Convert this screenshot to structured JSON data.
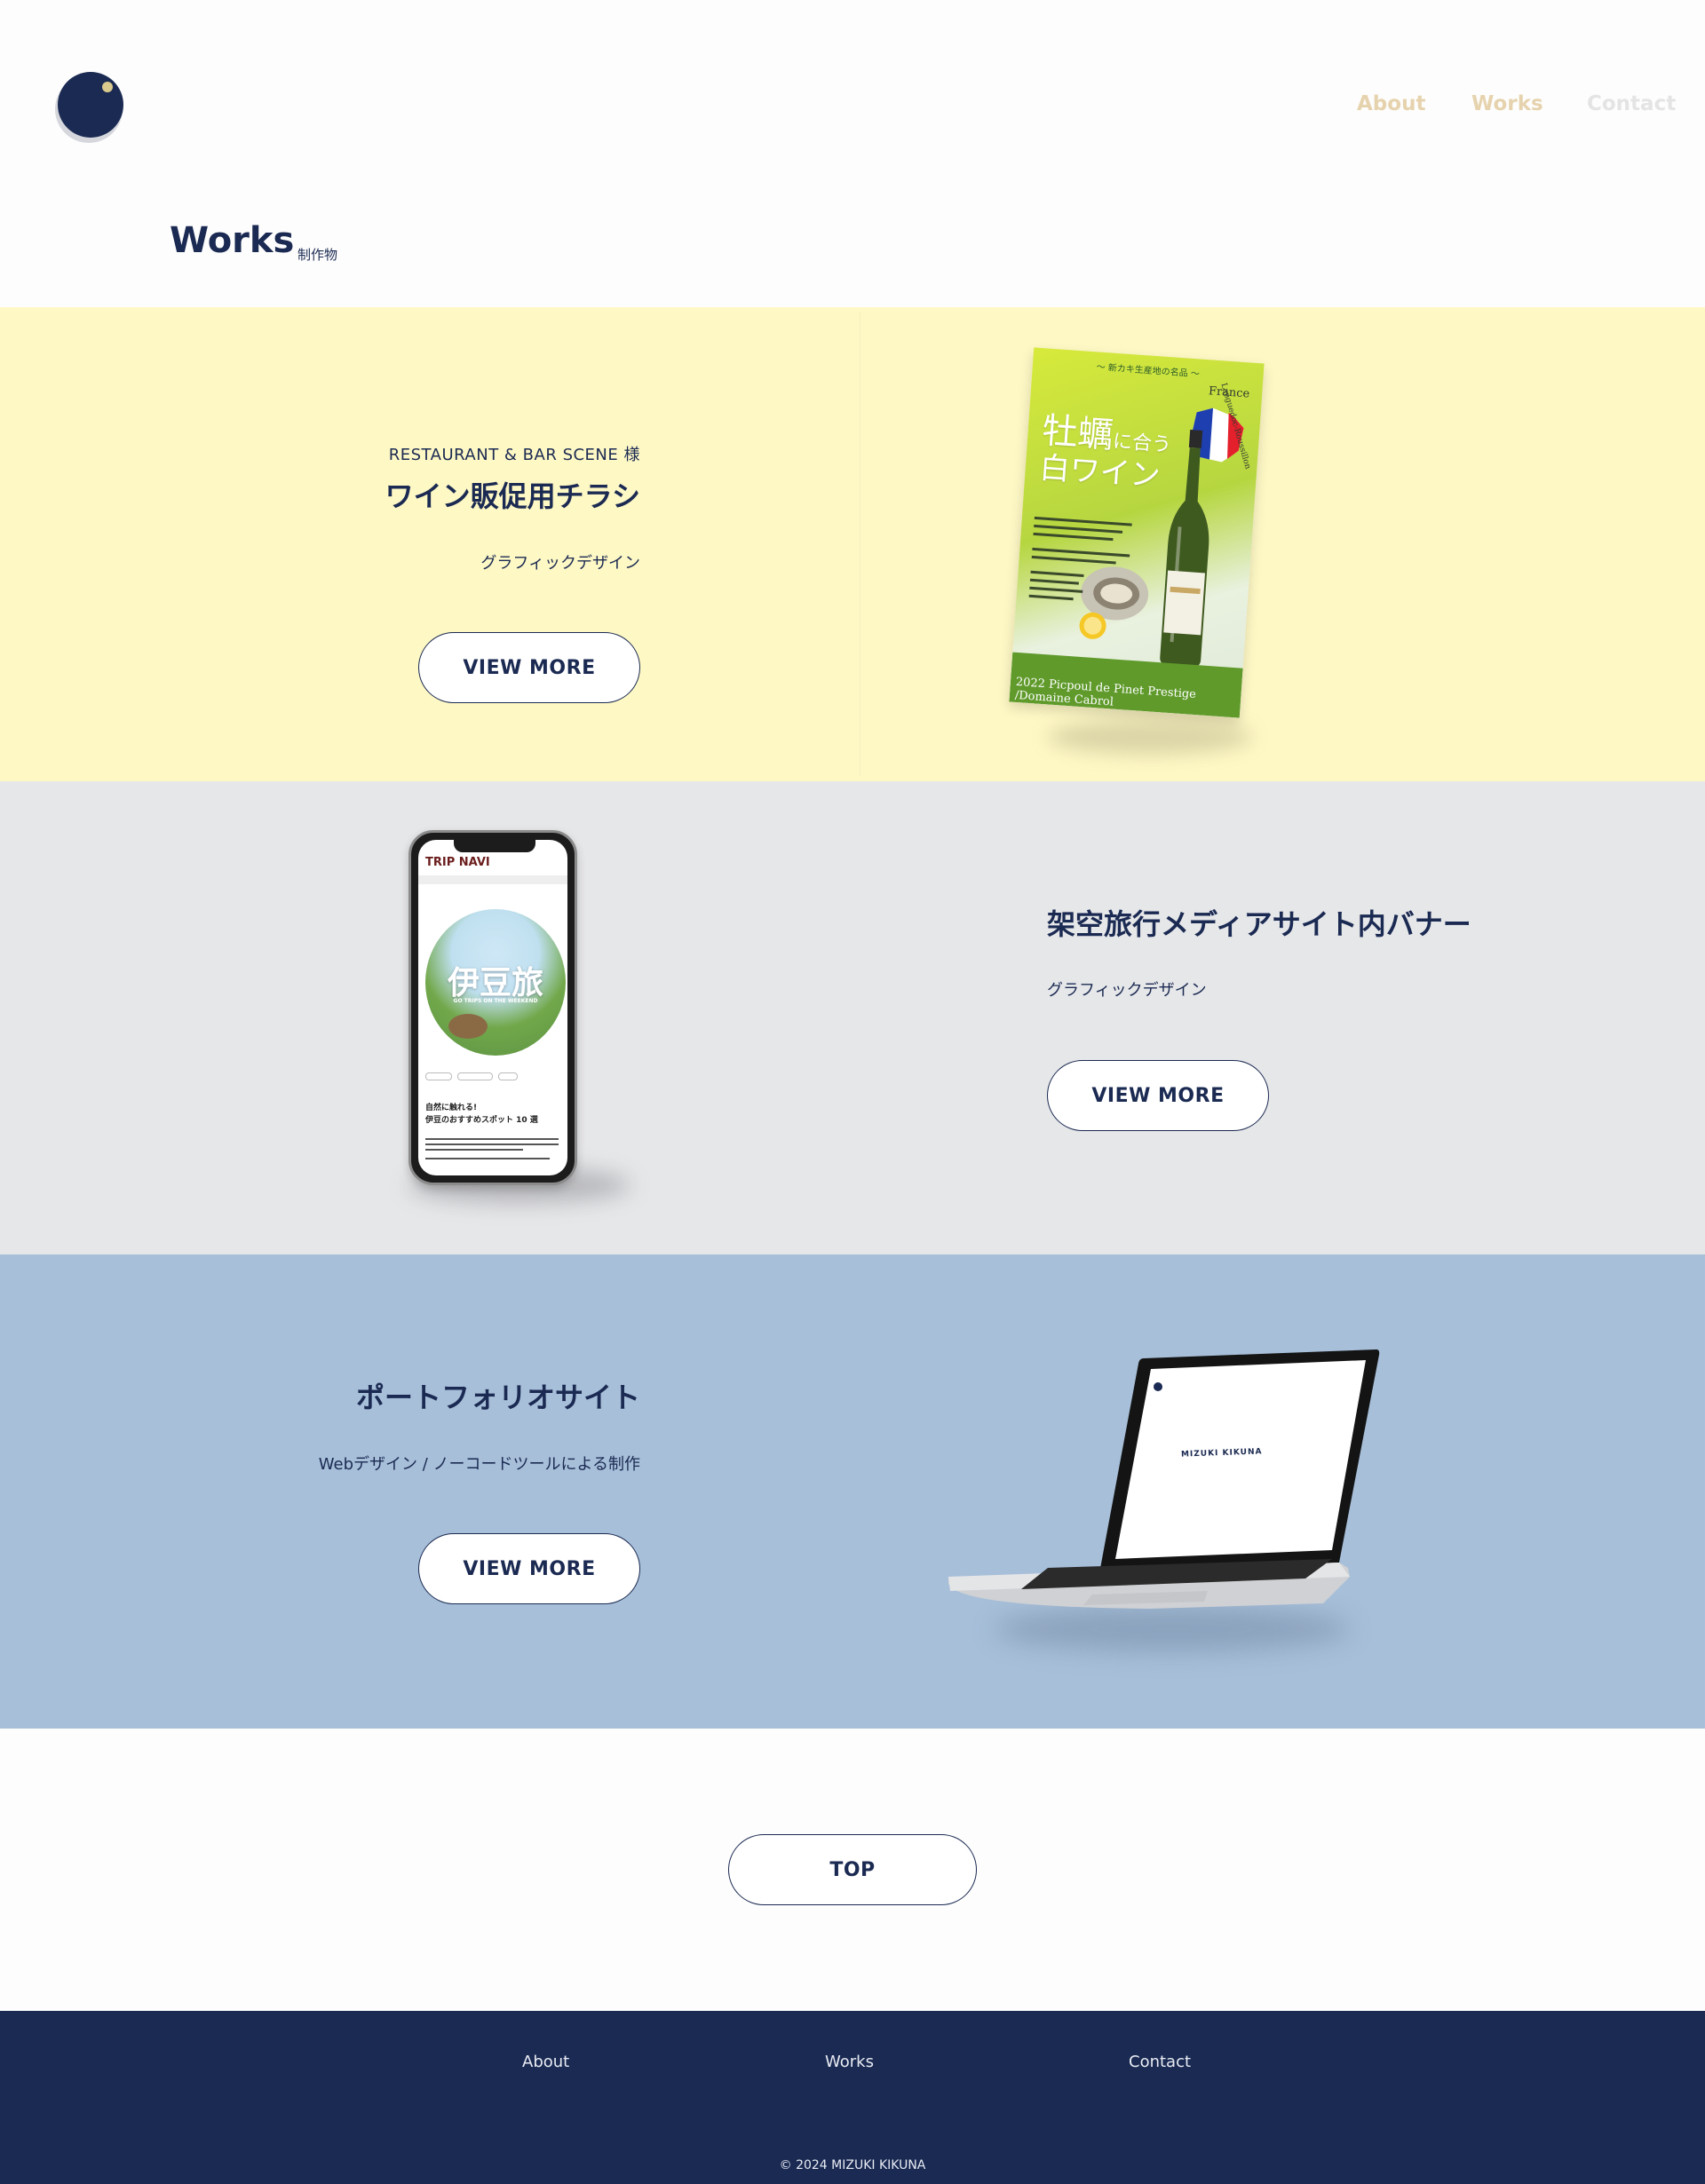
{
  "brand": {
    "logo_icon": "moon-circle-logo",
    "colors": {
      "navy": "#1b2a52",
      "gold": "#e6d3ae",
      "yellow_bg": "#fef8c5",
      "gray_bg": "#e6e7e9",
      "blue_bg": "#a7bfd9"
    }
  },
  "nav": {
    "items": [
      {
        "label": "About"
      },
      {
        "label": "Works"
      },
      {
        "label": "Contact"
      }
    ]
  },
  "page": {
    "title": "Works",
    "subtitle": "制作物"
  },
  "works": [
    {
      "client": "RESTAURANT & BAR SCENE 様",
      "title": "ワイン販促用チラシ",
      "category": "グラフィックデザイン",
      "button": "VIEW MORE",
      "image": {
        "icon": "wine-flyer-image",
        "header": "〜 新カキ生産地の名品 〜",
        "country": "France",
        "headline_1": "牡蠣",
        "headline_small": "に合う",
        "headline_2": "白ワイン",
        "region": "Languedoc-Roussillon",
        "bottom": "2022 Picpoul de Pinet Prestige /Domaine Cabrol"
      }
    },
    {
      "title": "架空旅行メディアサイト内バナー",
      "category": "グラフィックデザイン",
      "button": "VIEW MORE",
      "image": {
        "icon": "smartphone-mockup-image",
        "site": "TRIP NAVI",
        "banner": "伊豆旅",
        "banner_sub": "GO TRIPS ON THE WEEKEND",
        "article_1": "自然に触れる!",
        "article_2": "伊豆のおすすめスポット 10 選"
      }
    },
    {
      "title": "ポートフォリオサイト",
      "category": "Webデザイン / ノーコードツールによる制作",
      "button": "VIEW MORE",
      "image": {
        "icon": "laptop-mockup-image",
        "screen_text": "MIZUKI KIKUNA"
      }
    }
  ],
  "top_button": "TOP",
  "footer": {
    "links": [
      "About",
      "Works",
      "Contact"
    ],
    "copyright": "© 2024 MIZUKI KIKUNA"
  }
}
